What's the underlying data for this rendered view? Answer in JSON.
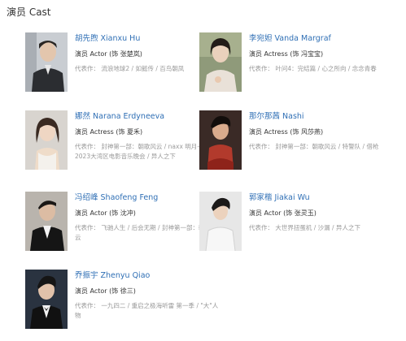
{
  "section": {
    "title": "演员 Cast"
  },
  "cast": [
    {
      "name": "胡先煦 Xianxu Hu",
      "role": "演员 Actor (饰 张楚岚)",
      "works": "代表作：  流浪地球2 / 如懿传 / 百鸟朝凤"
    },
    {
      "name": "李宛妲 Vanda Margraf",
      "role": "演员 Actress (饰 冯宝宝)",
      "works": "代表作：  叶问4：完结篇 / 心之所向 / 念念青春"
    },
    {
      "name": "娜然 Narana Erdyneeva",
      "role": "演员 Actress (饰 夏禾)",
      "works": "代表作：  封神第一部：朝歌风云 / naxx 明月——2023大湾区电影音乐晚会 / 异人之下"
    },
    {
      "name": "那尔那茜 Nashi",
      "role": "演员 Actress (饰 风莎燕)",
      "works": "代表作：  封神第一部：朝歌风云 / 特警队 / 借枪"
    },
    {
      "name": "冯绍峰 Shaofeng Feng",
      "role": "演员 Actor (饰 沈冲)",
      "works": "代表作：  飞驰人生 / 后会无期 / 封神第一部：朝歌风云"
    },
    {
      "name": "郭家楷 Jiakai Wu",
      "role": "演员 Actor (饰 张灵玉)",
      "works": "代表作：  大世界扭蛋机 / 沙漏 / 异人之下"
    },
    {
      "name": "乔振宇 Zhenyu Qiao",
      "role": "演员 Actor (饰 徐三)",
      "works": "代表作：  一九四二 / 重启之极海听雷 第一季 / \"大\"人物"
    }
  ],
  "colors": {
    "name_link": "#2f6fb5",
    "role_text": "#333333",
    "works_text": "#999999"
  }
}
